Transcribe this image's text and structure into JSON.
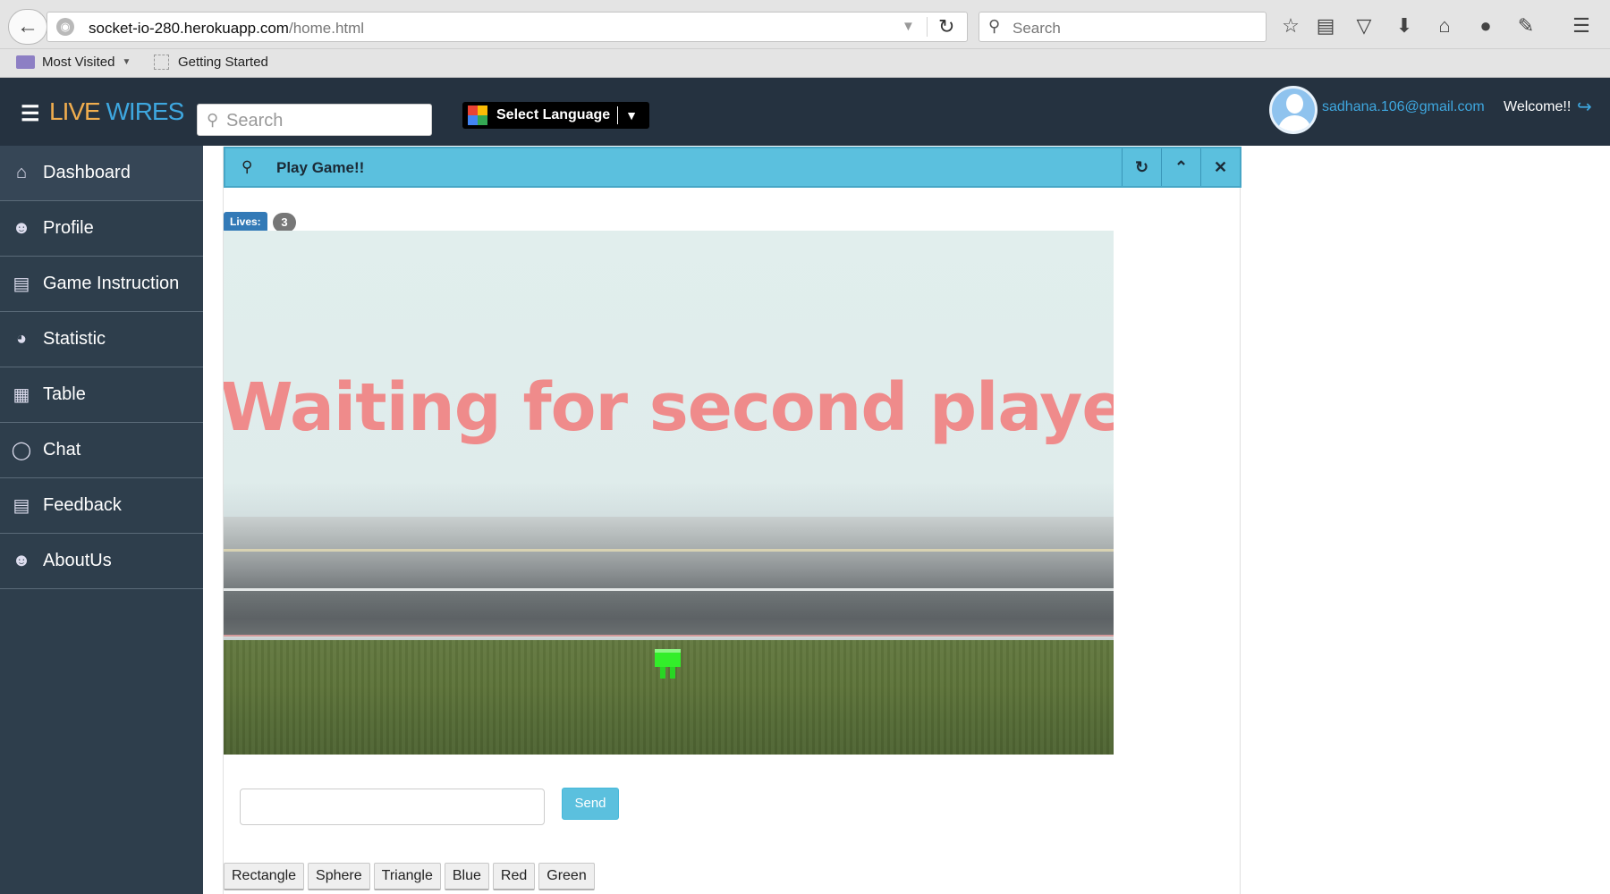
{
  "browser": {
    "url_host": "socket-io-280.herokuapp.com",
    "url_path": "/home.html",
    "search_placeholder": "Search",
    "bookmarks": [
      {
        "label": "Most Visited"
      },
      {
        "label": "Getting Started"
      }
    ]
  },
  "header": {
    "title_live": "LIVE",
    "title_wires": "WIRES",
    "search_placeholder": "Search",
    "language_label": "Select Language",
    "user_email": "sadhana.106@gmail.com",
    "welcome": "Welcome!!"
  },
  "sidebar": {
    "items": [
      {
        "label": "Dashboard",
        "icon": "home-icon"
      },
      {
        "label": "Profile",
        "icon": "user-icon"
      },
      {
        "label": "Game Instruction",
        "icon": "document-icon"
      },
      {
        "label": "Statistic",
        "icon": "pie-chart-icon"
      },
      {
        "label": "Table",
        "icon": "table-icon"
      },
      {
        "label": "Chat",
        "icon": "chat-icon"
      },
      {
        "label": "Feedback",
        "icon": "document-icon"
      },
      {
        "label": "AboutUs",
        "icon": "user-icon"
      }
    ]
  },
  "panel": {
    "title": "Play Game!!",
    "lives_label": "Lives:",
    "lives_count": "3",
    "game_message": "Waiting for second player",
    "send_label": "Send",
    "shape_buttons": [
      "Rectangle",
      "Sphere",
      "Triangle",
      "Blue",
      "Red",
      "Green"
    ]
  },
  "colors": {
    "header_bg": "#253240",
    "sidebar_bg": "#2e3e4c",
    "panel_header": "#5bc0de",
    "accent_orange": "#f0ad4e",
    "accent_blue": "#3ea7df",
    "player": "#33ee2a"
  }
}
